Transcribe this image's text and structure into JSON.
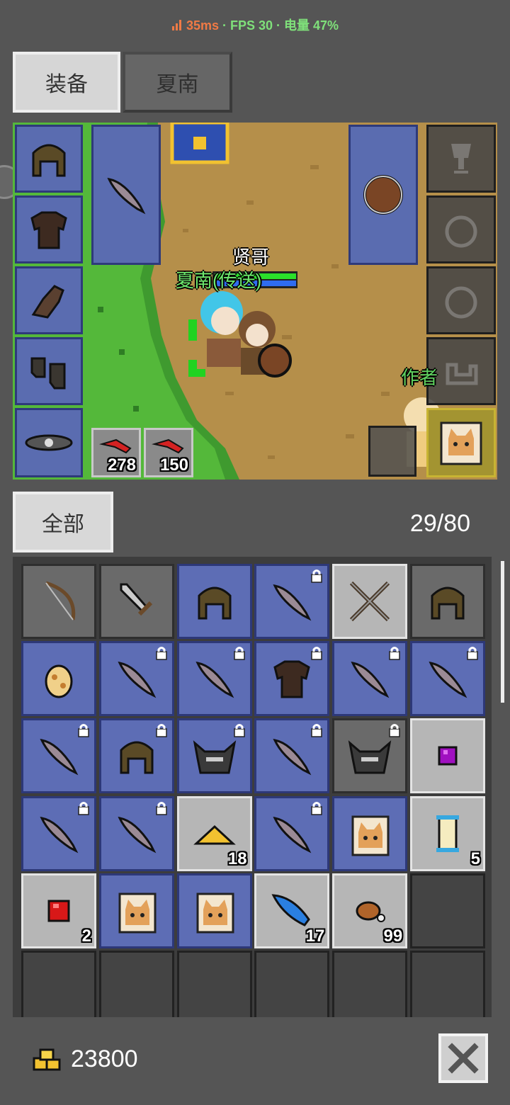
{
  "status": {
    "ping": "35ms",
    "rest": " · FPS 30 · 电量 47%"
  },
  "tabs": {
    "equipment": "装备",
    "character": "夏南"
  },
  "game": {
    "player_name": "贤哥",
    "companion_name": "夏南(传送)",
    "author_label": "作者",
    "ammo": [
      {
        "icon": "red-arrow-icon",
        "count": "278"
      },
      {
        "icon": "red-arrow-icon",
        "count": "150"
      }
    ]
  },
  "inventory": {
    "filter_label": "全部",
    "capacity": "29/80",
    "items": [
      {
        "icon": "bow-icon",
        "bg": "gray",
        "locked": false,
        "qty": ""
      },
      {
        "icon": "sword-icon",
        "bg": "gray",
        "locked": false,
        "qty": ""
      },
      {
        "icon": "helmet-icon",
        "bg": "blue",
        "locked": false,
        "qty": ""
      },
      {
        "icon": "feather-icon",
        "bg": "blue",
        "locked": true,
        "qty": ""
      },
      {
        "icon": "crossed-spears-icon",
        "bg": "light",
        "locked": false,
        "qty": ""
      },
      {
        "icon": "helmet-icon",
        "bg": "gray",
        "locked": false,
        "qty": ""
      },
      {
        "icon": "egg-icon",
        "bg": "blue",
        "locked": false,
        "qty": ""
      },
      {
        "icon": "feather-icon",
        "bg": "blue",
        "locked": true,
        "qty": ""
      },
      {
        "icon": "feather-icon",
        "bg": "blue",
        "locked": true,
        "qty": ""
      },
      {
        "icon": "armor-icon",
        "bg": "blue",
        "locked": true,
        "qty": ""
      },
      {
        "icon": "feather-icon",
        "bg": "blue",
        "locked": true,
        "qty": ""
      },
      {
        "icon": "feather-icon",
        "bg": "blue",
        "locked": true,
        "qty": ""
      },
      {
        "icon": "feather-icon",
        "bg": "blue",
        "locked": true,
        "qty": ""
      },
      {
        "icon": "helmet-icon",
        "bg": "blue",
        "locked": true,
        "qty": ""
      },
      {
        "icon": "horned-helmet-icon",
        "bg": "blue",
        "locked": true,
        "qty": ""
      },
      {
        "icon": "feather-icon",
        "bg": "blue",
        "locked": true,
        "qty": ""
      },
      {
        "icon": "horned-helmet-icon",
        "bg": "gray",
        "locked": true,
        "qty": ""
      },
      {
        "icon": "purple-gem-icon",
        "bg": "light",
        "locked": false,
        "qty": ""
      },
      {
        "icon": "feather-icon",
        "bg": "blue",
        "locked": true,
        "qty": ""
      },
      {
        "icon": "feather-icon",
        "bg": "blue",
        "locked": true,
        "qty": ""
      },
      {
        "icon": "gold-pile-icon",
        "bg": "light",
        "locked": false,
        "qty": "18"
      },
      {
        "icon": "feather-icon",
        "bg": "blue",
        "locked": true,
        "qty": ""
      },
      {
        "icon": "cat-card-male-icon",
        "bg": "blue",
        "locked": false,
        "qty": ""
      },
      {
        "icon": "scroll-icon",
        "bg": "light",
        "locked": false,
        "qty": "5"
      },
      {
        "icon": "red-gem-icon",
        "bg": "light",
        "locked": false,
        "qty": "2"
      },
      {
        "icon": "cat-card-female-icon",
        "bg": "blue",
        "locked": false,
        "qty": ""
      },
      {
        "icon": "cat-card-female-icon",
        "bg": "blue",
        "locked": false,
        "qty": ""
      },
      {
        "icon": "blue-feather-icon",
        "bg": "light",
        "locked": false,
        "qty": "17"
      },
      {
        "icon": "meat-icon",
        "bg": "light",
        "locked": false,
        "qty": "99"
      },
      {
        "icon": "",
        "bg": "empty",
        "locked": false,
        "qty": ""
      },
      {
        "icon": "",
        "bg": "empty",
        "locked": false,
        "qty": ""
      },
      {
        "icon": "",
        "bg": "empty",
        "locked": false,
        "qty": ""
      },
      {
        "icon": "",
        "bg": "empty",
        "locked": false,
        "qty": ""
      },
      {
        "icon": "",
        "bg": "empty",
        "locked": false,
        "qty": ""
      },
      {
        "icon": "",
        "bg": "empty",
        "locked": false,
        "qty": ""
      },
      {
        "icon": "",
        "bg": "empty",
        "locked": false,
        "qty": ""
      }
    ]
  },
  "footer": {
    "gold": "23800"
  },
  "colors": {
    "slot_blue": "#5d6db5",
    "slot_light": "#b6b6b6",
    "ping": "#f07a45",
    "status_green": "#7fe07a"
  }
}
